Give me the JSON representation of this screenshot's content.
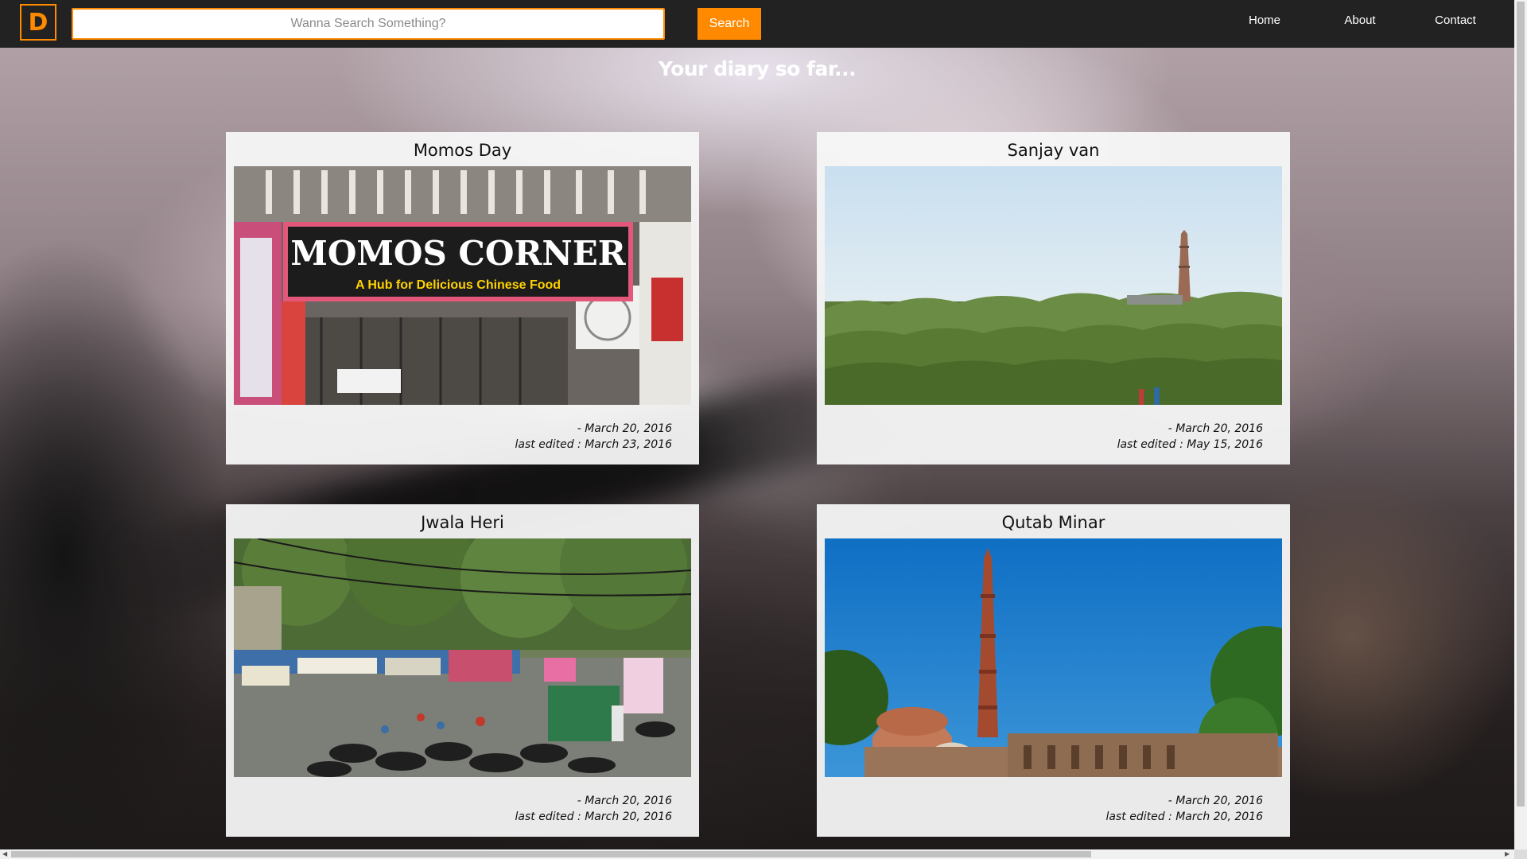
{
  "navbar": {
    "logo_letter": "D",
    "search": {
      "placeholder": "Wanna Search Something?",
      "value": ""
    },
    "search_button_label": "Search",
    "links": [
      "Home",
      "About",
      "Contact"
    ]
  },
  "page_title": "Your diary so far...",
  "entries": [
    {
      "title": "Momos Day",
      "image": "momos-corner-shop-photo",
      "created": "- March 20, 2016",
      "edited": "last edited : March 23, 2016",
      "sign_text": "MOMOS CORNER",
      "sign_subtext": "A Hub for Delicious Chinese Food"
    },
    {
      "title": "Sanjay van",
      "image": "sanjay-van-forest-photo",
      "created": "- March 20, 2016",
      "edited": "last edited : May 15, 2016"
    },
    {
      "title": "Jwala Heri",
      "image": "jwala-heri-market-photo",
      "created": "- March 20, 2016",
      "edited": "last edited : March 20, 2016"
    },
    {
      "title": "Qutab Minar",
      "image": "qutab-minar-photo",
      "created": "- March 20, 2016",
      "edited": "last edited : March 20, 2016"
    }
  ],
  "colors": {
    "accent": "#ff8a00",
    "navbar": "#222222",
    "card": "#f8f8f8"
  }
}
